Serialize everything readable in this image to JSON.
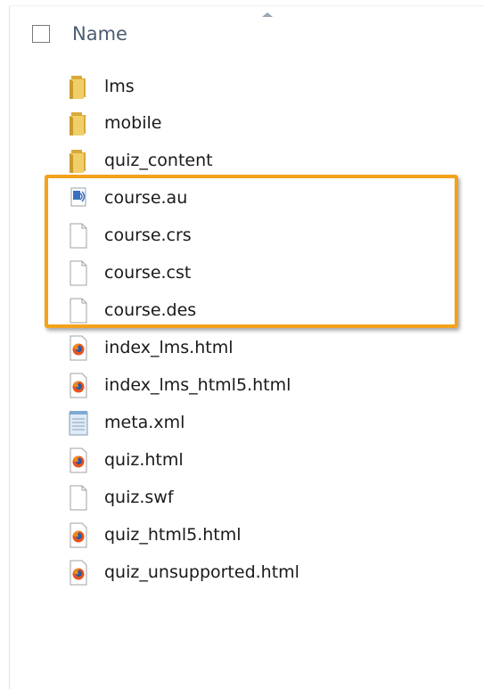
{
  "header": {
    "column_label": "Name"
  },
  "files": [
    {
      "name": "lms",
      "icon": "folder-icon"
    },
    {
      "name": "mobile",
      "icon": "folder-icon"
    },
    {
      "name": "quiz_content",
      "icon": "folder-icon"
    },
    {
      "name": "course.au",
      "icon": "audio-file-icon"
    },
    {
      "name": "course.crs",
      "icon": "blank-file-icon"
    },
    {
      "name": "course.cst",
      "icon": "blank-file-icon"
    },
    {
      "name": "course.des",
      "icon": "blank-file-icon"
    },
    {
      "name": "index_lms.html",
      "icon": "firefox-html-icon"
    },
    {
      "name": "index_lms_html5.html",
      "icon": "firefox-html-icon"
    },
    {
      "name": "meta.xml",
      "icon": "notepad-file-icon"
    },
    {
      "name": "quiz.html",
      "icon": "firefox-html-icon"
    },
    {
      "name": "quiz.swf",
      "icon": "blank-file-icon"
    },
    {
      "name": "quiz_html5.html",
      "icon": "firefox-html-icon"
    },
    {
      "name": "quiz_unsupported.html",
      "icon": "firefox-html-icon"
    }
  ],
  "colors": {
    "highlight_border": "#f4a21b",
    "header_text": "#4a5d72",
    "folder": "#e8c25a"
  }
}
